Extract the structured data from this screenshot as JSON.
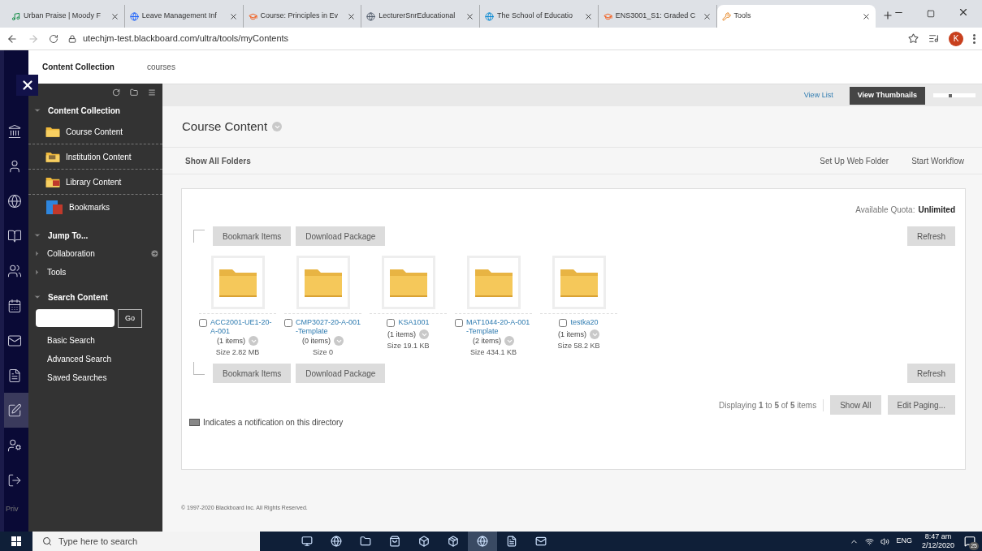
{
  "browser": {
    "tabs": [
      {
        "title": "Urban Praise | Moody F",
        "selected": false
      },
      {
        "title": "Leave Management Inf",
        "selected": false
      },
      {
        "title": "Course: Principles in Ev",
        "selected": false
      },
      {
        "title": "LecturerSnrEducational",
        "selected": false
      },
      {
        "title": "The School of Educatio",
        "selected": false
      },
      {
        "title": "ENS3001_S1: Graded C",
        "selected": false
      },
      {
        "title": "Tools",
        "selected": true
      }
    ],
    "url": "utechjm-test.blackboard.com/ultra/tools/myContents",
    "profile_initial": "K"
  },
  "breadcrumb": [
    {
      "label": "Content Collection",
      "current": true
    },
    {
      "label": "courses",
      "current": false
    }
  ],
  "nav_rail": {
    "items": [
      {
        "selected": false
      },
      {
        "selected": false
      },
      {
        "selected": false
      },
      {
        "selected": false
      },
      {
        "selected": false
      },
      {
        "selected": false
      },
      {
        "selected": false
      },
      {
        "selected": false
      },
      {
        "selected": true
      },
      {
        "selected": false
      },
      {
        "selected": false
      }
    ],
    "footer": "Priv"
  },
  "sidebar": {
    "sections": [
      {
        "kind": "collection",
        "title": "Content Collection",
        "expanded": true,
        "items": [
          {
            "label": "Course Content"
          },
          {
            "label": "Institution Content"
          },
          {
            "label": "Library Content"
          },
          {
            "label": "Bookmarks"
          }
        ]
      },
      {
        "kind": "jump",
        "title": "Jump To...",
        "expanded": true,
        "items": [
          {
            "label": "Collaboration",
            "expanded": false
          },
          {
            "label": "Tools",
            "expanded": false
          }
        ]
      },
      {
        "kind": "search",
        "title": "Search Content",
        "expanded": true,
        "button": "Go",
        "links": [
          "Basic Search",
          "Advanced Search",
          "Saved Searches"
        ]
      }
    ]
  },
  "view_toggle": [
    {
      "label": "View List",
      "selected": false
    },
    {
      "label": "View Thumbnails",
      "selected": true
    }
  ],
  "thumbnail_size": {
    "level": 0.4
  },
  "page_title": "Course Content",
  "action_bar": {
    "left": "Show All Folders",
    "right": [
      "Set Up Web Folder",
      "Start Workflow"
    ]
  },
  "quota": {
    "label": "Available Quota:",
    "value": "Unlimited"
  },
  "top_actions": [
    "Bookmark Items",
    "Download Package"
  ],
  "bottom_actions": [
    "Bookmark Items",
    "Download Package"
  ],
  "refresh_top": "Refresh",
  "refresh_bottom": "Refresh",
  "folders": [
    {
      "name": "ACC2001-UE1-20-A-001",
      "items": "(1 items)",
      "size": "Size 2.82 MB",
      "checked": false
    },
    {
      "name": "CMP3027-20-A-001-Template",
      "items": "(0 items)",
      "size": "Size 0",
      "checked": false
    },
    {
      "name": "KSA1001",
      "items": "(1 items)",
      "size": "Size 19.1 KB",
      "checked": false
    },
    {
      "name": "MAT1044-20-A-001-Template",
      "items": "(2 items)",
      "size": "Size 434.1 KB",
      "checked": false
    },
    {
      "name": "testka20",
      "items": "(1 items)",
      "size": "Size 58.2 KB",
      "checked": false
    }
  ],
  "paging": {
    "text": "Displaying **1** to **5** of **5** items",
    "buttons": [
      "Show All",
      "Edit Paging..."
    ]
  },
  "legend": "Indicates a notification on this directory",
  "footer": "© 1997-2020 Blackboard Inc. All Rights Reserved.",
  "taskbar": {
    "search_placeholder": "Type here to search",
    "apps": [
      {
        "active": false
      },
      {
        "active": false
      },
      {
        "active": false
      },
      {
        "active": false
      },
      {
        "active": false
      },
      {
        "active": false
      },
      {
        "active": true
      },
      {
        "active": false
      },
      {
        "active": false
      }
    ],
    "language": "ENG",
    "time": "8:47 am",
    "date": "2/12/2020",
    "notifications": "25"
  }
}
